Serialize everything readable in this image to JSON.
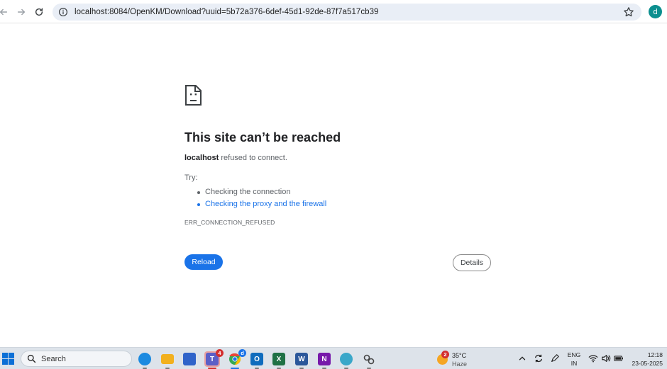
{
  "browser": {
    "url": "localhost:8084/OpenKM/Download?uuid=5b72a376-6def-45d1-92de-87f7a517cb39",
    "profile_initial": "d"
  },
  "error_page": {
    "title": "This site can’t be reached",
    "host": "localhost",
    "message": " refused to connect.",
    "try_label": "Try:",
    "suggestions": [
      "Checking the connection",
      "Checking the proxy and the firewall"
    ],
    "error_code": "ERR_CONNECTION_REFUSED",
    "reload_label": "Reload",
    "details_label": "Details"
  },
  "taskbar": {
    "search_placeholder": "Search",
    "apps": [
      {
        "name": "edge",
        "letter": "e",
        "color": "#1b8ae0"
      },
      {
        "name": "file-explorer",
        "letter": "",
        "color": "#f2b01e"
      },
      {
        "name": "microsoft-store",
        "letter": "",
        "color": "#2f63c9"
      },
      {
        "name": "teams",
        "letter": "T",
        "color": "#5b5fc7",
        "badge": "4"
      },
      {
        "name": "chrome",
        "letter": "",
        "color": "#34a853",
        "badge": "d"
      },
      {
        "name": "outlook",
        "letter": "O",
        "color": "#0f6cbd"
      },
      {
        "name": "excel",
        "letter": "X",
        "color": "#1e7145"
      },
      {
        "name": "word",
        "letter": "W",
        "color": "#2b579a"
      },
      {
        "name": "onenote",
        "letter": "N",
        "color": "#7719aa"
      },
      {
        "name": "app-a",
        "letter": "",
        "color": "#3aa7c9"
      },
      {
        "name": "app-b",
        "letter": "",
        "color": "#555555"
      }
    ],
    "weather": {
      "temperature": "35°C",
      "condition": "Haze",
      "badge": "2"
    },
    "language": {
      "line1": "ENG",
      "line2": "IN"
    },
    "clock": {
      "time": "12:18",
      "date": "23-05-2025"
    }
  },
  "colors": {
    "link": "#1a73e8",
    "reload_button": "#1a73e8",
    "teams_badge": "#d32f2f",
    "chrome_badge": "#1a73e8"
  }
}
